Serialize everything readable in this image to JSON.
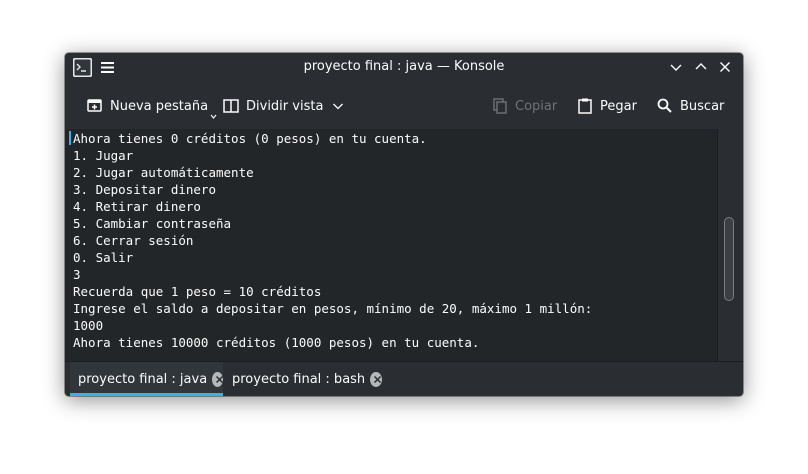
{
  "window": {
    "title": "proyecto final : java — Konsole"
  },
  "toolbar": {
    "new_tab_label": "Nueva pestaña",
    "split_view_label": "Dividir vista",
    "copy_label": "Copiar",
    "paste_label": "Pegar",
    "find_label": "Buscar"
  },
  "terminal": {
    "lines": [
      "Ahora tienes 0 créditos (0 pesos) en tu cuenta.",
      "1. Jugar",
      "2. Jugar automáticamente",
      "3. Depositar dinero",
      "4. Retirar dinero",
      "5. Cambiar contraseña",
      "6. Cerrar sesión",
      "0. Salir",
      "3",
      "Recuerda que 1 peso = 10 créditos",
      "Ingrese el saldo a depositar en pesos, mínimo de 20, máximo 1 millón:",
      "1000",
      "Ahora tienes 10000 créditos (1000 pesos) en tu cuenta."
    ]
  },
  "tabs": [
    {
      "label": "proyecto final : java",
      "active": true
    },
    {
      "label": "proyecto final : bash",
      "active": false
    }
  ],
  "colors": {
    "accent": "#3daee9",
    "window_bg": "#2a2e32",
    "terminal_bg": "#232629",
    "text": "#fcfcfc"
  }
}
